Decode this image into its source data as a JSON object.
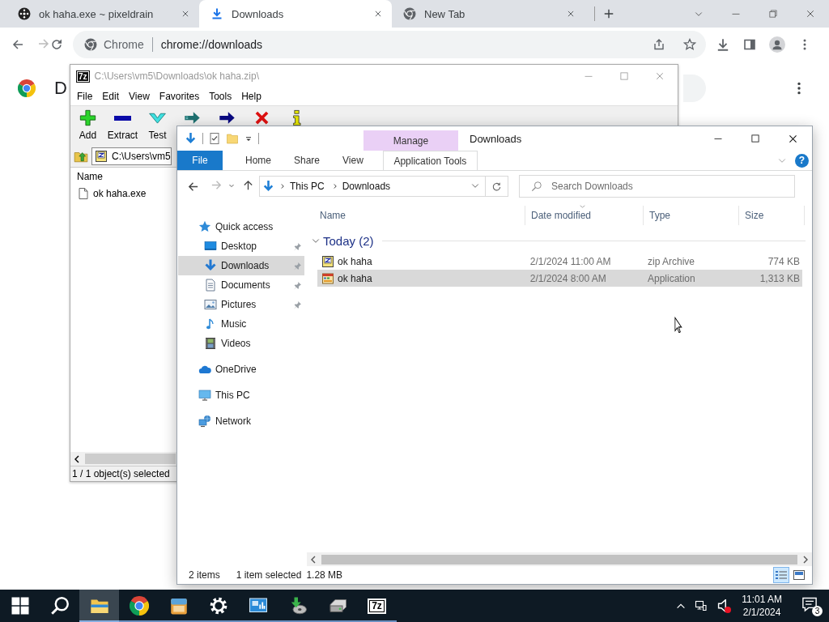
{
  "browser": {
    "tabs": [
      {
        "title": "ok haha.exe ~ pixeldrain",
        "kind": "site",
        "selected": false
      },
      {
        "title": "Downloads",
        "kind": "download",
        "selected": true
      },
      {
        "title": "New Tab",
        "kind": "chrome",
        "selected": false
      }
    ],
    "omnibox": {
      "site": "Chrome",
      "url": "chrome://downloads"
    },
    "page": {
      "heading": "D"
    }
  },
  "archive_window": {
    "logo": "7z",
    "title": "C:\\Users\\vm5\\Downloads\\ok haha.zip\\",
    "menu": [
      "File",
      "Edit",
      "View",
      "Favorites",
      "Tools",
      "Help"
    ],
    "toolbar": [
      {
        "kind": "add",
        "label": "Add"
      },
      {
        "kind": "extract",
        "label": "Extract"
      },
      {
        "kind": "test",
        "label": "Test"
      },
      {
        "kind": "copy"
      },
      {
        "kind": "move"
      },
      {
        "kind": "delete"
      },
      {
        "kind": "info"
      }
    ],
    "path": "C:\\Users\\vm5",
    "columns": [
      "Name"
    ],
    "files": [
      {
        "name": "ok haha.exe"
      }
    ],
    "status": "1 / 1 object(s) selected"
  },
  "explorer": {
    "title": "Downloads",
    "context_group": "Manage",
    "help": "?",
    "ribbon_tabs": [
      {
        "label": "File",
        "kind": "file",
        "selected": false
      },
      {
        "label": "Home",
        "kind": "tab",
        "selected": false
      },
      {
        "label": "Share",
        "kind": "tab",
        "selected": false
      },
      {
        "label": "View",
        "kind": "tab",
        "selected": false
      },
      {
        "label": "Application Tools",
        "kind": "context",
        "selected": false
      }
    ],
    "breadcrumb": [
      "This PC",
      "Downloads"
    ],
    "search": {
      "placeholder": "Search Downloads"
    },
    "nav": [
      {
        "label": "Quick access",
        "kind": "star",
        "selected": false,
        "children": [
          {
            "label": "Desktop",
            "kind": "desktop",
            "pinned": true,
            "selected": false
          },
          {
            "label": "Downloads",
            "kind": "down",
            "pinned": true,
            "selected": true
          },
          {
            "label": "Documents",
            "kind": "doc",
            "pinned": true,
            "selected": false
          },
          {
            "label": "Pictures",
            "kind": "pics",
            "pinned": true,
            "selected": false
          },
          {
            "label": "Music",
            "kind": "music",
            "pinned": false,
            "selected": false
          },
          {
            "label": "Videos",
            "kind": "film",
            "pinned": false,
            "selected": false
          }
        ]
      },
      {
        "label": "OneDrive",
        "kind": "cloud",
        "selected": false
      },
      {
        "label": "This PC",
        "kind": "pc",
        "selected": false
      },
      {
        "label": "Network",
        "kind": "net",
        "selected": false
      }
    ],
    "columns": [
      {
        "label": "Name",
        "sorted": false
      },
      {
        "label": "Date modified",
        "sorted": true
      },
      {
        "label": "Type",
        "sorted": false
      },
      {
        "label": "Size",
        "sorted": false
      }
    ],
    "groups": [
      {
        "label": "Today (2)",
        "expanded": true,
        "rows": [
          {
            "name": "ok haha",
            "kind": "zip",
            "date": "2/1/2024 11:00 AM",
            "type": "zip Archive",
            "size": "774 KB",
            "selected": false
          },
          {
            "name": "ok haha",
            "kind": "app",
            "date": "2/1/2024 8:00 AM",
            "type": "Application",
            "size": "1,313 KB",
            "selected": true
          }
        ]
      }
    ],
    "status": {
      "count": "2 items",
      "selection": "1 item selected",
      "size": "1.28 MB"
    },
    "views": [
      {
        "kind": "details",
        "selected": true
      },
      {
        "kind": "large",
        "selected": false
      }
    ]
  },
  "taskbar": {
    "apps": [
      {
        "kind": "start",
        "running": false,
        "selected": false
      },
      {
        "kind": "search",
        "running": false,
        "selected": false
      },
      {
        "kind": "explorer",
        "running": true,
        "selected": true
      },
      {
        "kind": "chrome",
        "running": true,
        "selected": false
      },
      {
        "kind": "box",
        "running": true,
        "selected": false
      },
      {
        "kind": "settings",
        "running": true,
        "selected": false
      },
      {
        "kind": "monitor",
        "running": true,
        "selected": false
      },
      {
        "kind": "installer",
        "running": true,
        "selected": false
      },
      {
        "kind": "drive",
        "running": true,
        "selected": false
      },
      {
        "kind": "archiver",
        "label": "7z",
        "running": true,
        "selected": false
      }
    ],
    "muted": true,
    "time": "11:01 AM",
    "date": "2/1/2024",
    "notifications": "3"
  }
}
